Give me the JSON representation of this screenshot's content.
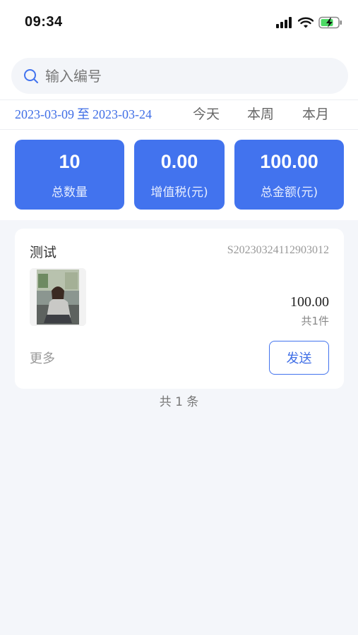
{
  "status_bar": {
    "time": "09:34",
    "icons": [
      "signal-icon",
      "wifi-icon",
      "battery-charging-icon"
    ]
  },
  "search": {
    "placeholder": "输入编号",
    "value": ""
  },
  "date_filter": {
    "start": "2023-03-09",
    "separator": "至",
    "end": "2023-03-24",
    "quick_options": [
      "今天",
      "本周",
      "本月"
    ]
  },
  "stats": [
    {
      "value": "10",
      "label": "总数量"
    },
    {
      "value": "0.00",
      "label": "增值税(元)"
    },
    {
      "value": "100.00",
      "label": "总金额(元)"
    }
  ],
  "orders": [
    {
      "name": "测试",
      "order_no": "S20230324112903012",
      "price": "100.00",
      "qty_text": "共1件",
      "more_label": "更多",
      "send_label": "发送"
    }
  ],
  "footer": {
    "count_text": "共 1 条"
  },
  "colors": {
    "accent": "#4273ee",
    "background": "#f4f6fa",
    "card": "#ffffff"
  }
}
